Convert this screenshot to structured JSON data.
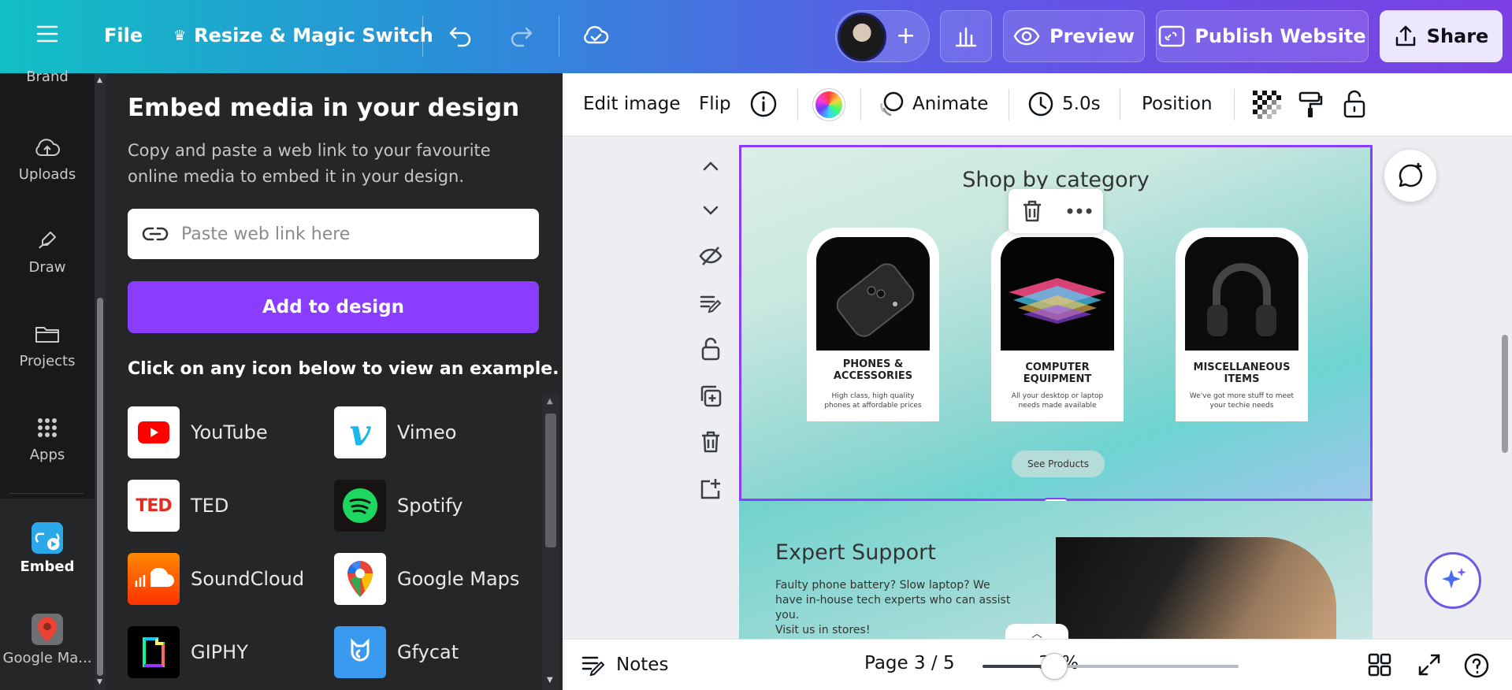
{
  "topbar": {
    "file": "File",
    "resize": "Resize & Magic Switch",
    "preview": "Preview",
    "publish": "Publish Website",
    "share": "Share"
  },
  "sidebar": {
    "partial_top": "Brand",
    "items": [
      {
        "label": "Uploads",
        "icon": "upload-cloud-icon"
      },
      {
        "label": "Draw",
        "icon": "draw-icon"
      },
      {
        "label": "Projects",
        "icon": "folder-icon"
      },
      {
        "label": "Apps",
        "icon": "apps-grid-icon"
      },
      {
        "label": "Embed",
        "icon": "embed-icon"
      },
      {
        "label": "Google Ma...",
        "icon": "google-maps-icon"
      }
    ]
  },
  "panel": {
    "title": "Embed media in your design",
    "description": "Copy and paste a web link to your favourite online media to embed it in your design.",
    "input_placeholder": "Paste web link here",
    "add_button": "Add to design",
    "hint": "Click on any icon below to view an example.",
    "providers": [
      {
        "name": "YouTube"
      },
      {
        "name": "Vimeo"
      },
      {
        "name": "TED"
      },
      {
        "name": "Spotify"
      },
      {
        "name": "SoundCloud"
      },
      {
        "name": "Google Maps"
      },
      {
        "name": "GIPHY"
      },
      {
        "name": "Gfycat"
      }
    ]
  },
  "toolbar": {
    "edit_image": "Edit image",
    "flip": "Flip",
    "animate": "Animate",
    "duration": "5.0s",
    "position": "Position"
  },
  "canvas": {
    "shop_title": "Shop by category",
    "cards": [
      {
        "title": "PHONES & ACCESSORIES",
        "desc": "High class, high quality phones at affordable prices"
      },
      {
        "title": "COMPUTER EQUIPMENT",
        "desc": "All your desktop or laptop needs made available"
      },
      {
        "title": "MISCELLANEOUS ITEMS",
        "desc": "We've got more stuff to meet your techie needs"
      }
    ],
    "see_products": "See Products",
    "expert_title": "Expert Support",
    "expert_desc": "Faulty phone battery? Slow laptop? We have in-house tech experts who can assist you.",
    "expert_visit": "Visit us in stores!"
  },
  "bottombar": {
    "notes": "Notes",
    "page": "Page 3 / 5",
    "zoom": "36%",
    "zoom_fraction": 0.28
  },
  "colors": {
    "accent": "#8b3dff",
    "sidebar_bg": "#18191b",
    "panel_bg": "#252627"
  }
}
